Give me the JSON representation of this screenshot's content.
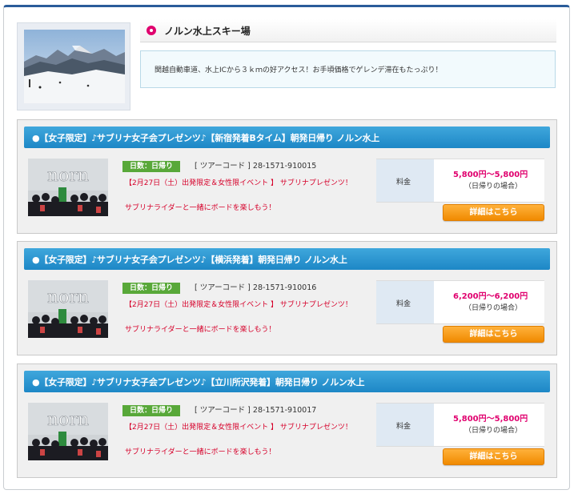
{
  "resort": {
    "name": "ノルン水上スキー場",
    "description": "関越自動車道、水上ICから３ｋｍの好アクセス！お手頃価格でゲレンデ滞在もたっぷり！"
  },
  "tours": [
    {
      "title": "●【女子限定】♪サブリナ女子会プレゼンツ♪【新宿発着Bタイム】朝発日帰り ノルン水上",
      "days": "日数：日帰り",
      "code": "[ ツアーコード ] 28-1571-910015",
      "event": "【2月27日（土）出発限定＆女性限イベント 】 サブリナプレゼンツ！",
      "cta": "サブリナライダーと一緒にボードを楽しもう！",
      "price_label": "料金",
      "price": "5,800円～5,800円",
      "price_note": "（日帰りの場合）",
      "button": "詳細はこちら",
      "photo_text": "norn"
    },
    {
      "title": "●【女子限定】♪サブリナ女子会プレゼンツ♪【横浜発着】朝発日帰り ノルン水上",
      "days": "日数：日帰り",
      "code": "[ ツアーコード ] 28-1571-910016",
      "event": "【2月27日（土）出発限定＆女性限イベント 】 サブリナプレゼンツ！",
      "cta": "サブリナライダーと一緒にボードを楽しもう！",
      "price_label": "料金",
      "price": "6,200円～6,200円",
      "price_note": "（日帰りの場合）",
      "button": "詳細はこちら",
      "photo_text": "norn"
    },
    {
      "title": "●【女子限定】♪サブリナ女子会プレゼンツ♪【立川所沢発着】朝発日帰り ノルン水上",
      "days": "日数：日帰り",
      "code": "[ ツアーコード ] 28-1571-910017",
      "event": "【2月27日（土）出発限定＆女性限イベント 】 サブリナプレゼンツ！",
      "cta": "サブリナライダーと一緒にボードを楽しもう！",
      "price_label": "料金",
      "price": "5,800円～5,800円",
      "price_note": "（日帰りの場合）",
      "button": "詳細はこちら",
      "photo_text": "norn"
    }
  ],
  "colors": {
    "title_bar": "#1d87c6",
    "days_badge": "#58a839",
    "price": "#e0006e",
    "event_text": "#d6002a",
    "button": "#f08a00"
  }
}
